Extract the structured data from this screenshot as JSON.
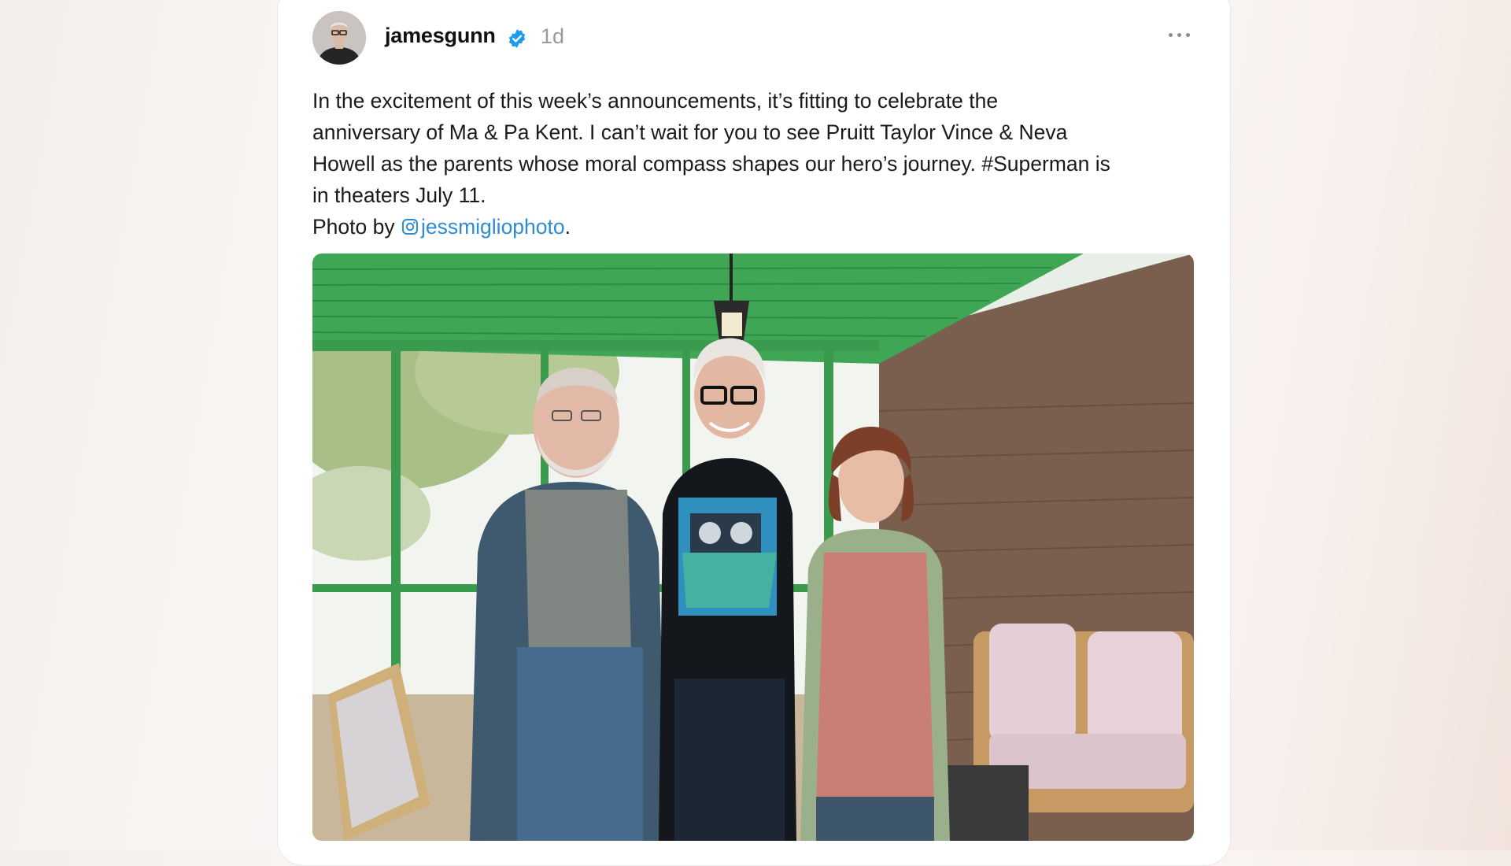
{
  "post": {
    "username": "jamesgunn",
    "timestamp": "1d",
    "caption_lines": [
      "In the excitement of this week’s announcements, it’s fitting to celebrate the",
      "anniversary of Ma & Pa Kent. I can’t wait for you to see Pruitt Taylor Vince & Neva",
      "Howell as the parents whose moral compass shapes our hero’s journey. #Superman is",
      "in theaters July 11."
    ],
    "credit_prefix": "Photo by ",
    "credit_handle": "jessmigliophoto",
    "credit_suffix": "."
  },
  "icons": {
    "verified": "verified-badge-icon",
    "more": "more-options-icon",
    "instagram": "instagram-icon"
  },
  "colors": {
    "link": "#2d8bd1",
    "verified": "#1d9bf0"
  }
}
